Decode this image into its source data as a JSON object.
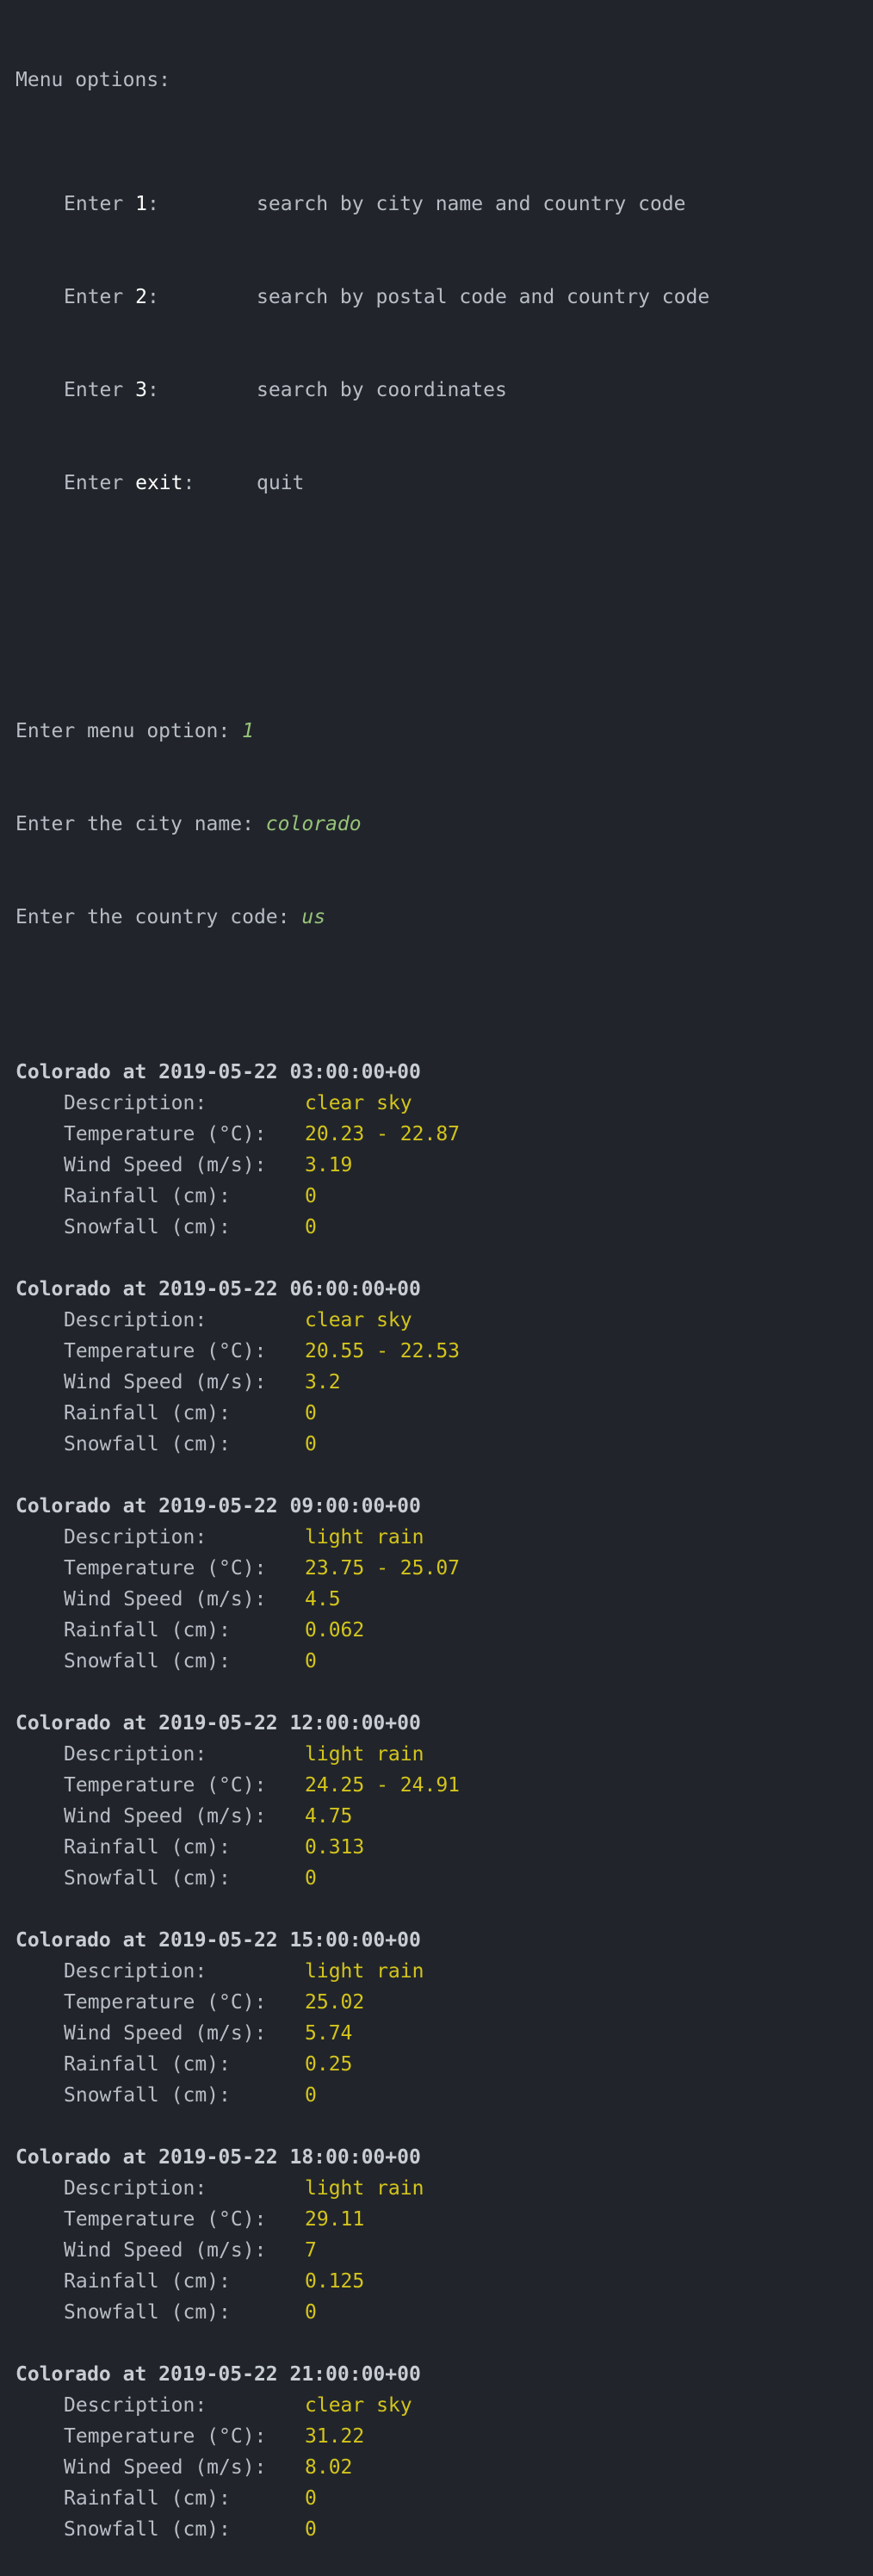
{
  "menu": {
    "header": "Menu options:",
    "options": [
      {
        "prefix": "Enter ",
        "key": "1",
        "suffix": ":",
        "desc": "search by city name and country code"
      },
      {
        "prefix": "Enter ",
        "key": "2",
        "suffix": ":",
        "desc": "search by postal code and country code"
      },
      {
        "prefix": "Enter ",
        "key": "3",
        "suffix": ":",
        "desc": "search by coordinates"
      },
      {
        "prefix": "Enter ",
        "key": "exit",
        "suffix": ":",
        "desc": "quit"
      }
    ]
  },
  "prompts": [
    {
      "label": "Enter menu option: ",
      "value": "1"
    },
    {
      "label": "Enter the city name: ",
      "value": "colorado"
    },
    {
      "label": "Enter the country code: ",
      "value": "us"
    }
  ],
  "field_labels": {
    "description": "Description:",
    "temperature": "Temperature (°C):",
    "wind": "Wind Speed (m/s):",
    "rain": "Rainfall (cm):",
    "snow": "Snowfall (cm):"
  },
  "records": [
    {
      "title": "Colorado at 2019-05-22 03:00:00+00",
      "description": "clear sky",
      "temperature": "20.23 - 22.87",
      "wind": "3.19",
      "rain": "0",
      "snow": "0"
    },
    {
      "title": "Colorado at 2019-05-22 06:00:00+00",
      "description": "clear sky",
      "temperature": "20.55 - 22.53",
      "wind": "3.2",
      "rain": "0",
      "snow": "0"
    },
    {
      "title": "Colorado at 2019-05-22 09:00:00+00",
      "description": "light rain",
      "temperature": "23.75 - 25.07",
      "wind": "4.5",
      "rain": "0.062",
      "snow": "0"
    },
    {
      "title": "Colorado at 2019-05-22 12:00:00+00",
      "description": "light rain",
      "temperature": "24.25 - 24.91",
      "wind": "4.75",
      "rain": "0.313",
      "snow": "0"
    },
    {
      "title": "Colorado at 2019-05-22 15:00:00+00",
      "description": "light rain",
      "temperature": "25.02",
      "wind": "5.74",
      "rain": "0.25",
      "snow": "0"
    },
    {
      "title": "Colorado at 2019-05-22 18:00:00+00",
      "description": "light rain",
      "temperature": "29.11",
      "wind": "7",
      "rain": "0.125",
      "snow": "0"
    },
    {
      "title": "Colorado at 2019-05-22 21:00:00+00",
      "description": "clear sky",
      "temperature": "31.22",
      "wind": "8.02",
      "rain": "0",
      "snow": "0"
    }
  ],
  "colors": {
    "background": "#21252b",
    "text": "#b8bcc4",
    "value": "#d4c41c",
    "input": "#98c379"
  }
}
